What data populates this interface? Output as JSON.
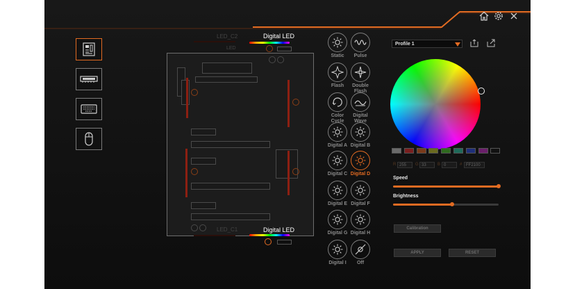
{
  "window": {
    "home_icon": "home-icon",
    "settings_icon": "gear-icon",
    "close_icon": "close-icon"
  },
  "sidebar": {
    "items": [
      {
        "name": "motherboard",
        "icon": "motherboard-icon",
        "active": true
      },
      {
        "name": "memory",
        "icon": "memory-icon",
        "active": false
      },
      {
        "name": "keyboard",
        "icon": "keyboard-icon",
        "active": false
      },
      {
        "name": "mouse",
        "icon": "mouse-icon",
        "active": false
      }
    ]
  },
  "board": {
    "led_c2": "LED_C2",
    "led_c1": "LED_C1",
    "digital_led_top": "Digital LED",
    "digital_led_bottom": "Digital LED",
    "led_small": "LED"
  },
  "effects": [
    {
      "label": "Static",
      "icon": "sun-icon"
    },
    {
      "label": "Pulse",
      "icon": "wave-icon"
    },
    {
      "label": "Flash",
      "icon": "flash-icon"
    },
    {
      "label": "Double\nFlash",
      "icon": "double-flash-icon"
    },
    {
      "label": "Color\nCycle",
      "icon": "color-cycle-icon"
    },
    {
      "label": "Digital\nWave",
      "icon": "digital-wave-icon"
    },
    {
      "label": "Digital A",
      "icon": "sun-icon"
    },
    {
      "label": "Digital B",
      "icon": "sun-icon"
    },
    {
      "label": "Digital C",
      "icon": "sun-icon"
    },
    {
      "label": "Digital D",
      "icon": "sun-icon",
      "active": true
    },
    {
      "label": "Digital E",
      "icon": "sun-icon"
    },
    {
      "label": "Digital F",
      "icon": "sun-icon"
    },
    {
      "label": "Digital G",
      "icon": "sun-icon"
    },
    {
      "label": "Digital H",
      "icon": "sun-icon"
    },
    {
      "label": "Digital I",
      "icon": "sun-icon"
    },
    {
      "label": "Off",
      "icon": "off-icon"
    }
  ],
  "profile": {
    "selected": "Profile 1",
    "import_icon": "import-icon",
    "export_icon": "export-icon"
  },
  "swatches": [
    "#6b6b6b",
    "#7a1f1f",
    "#7a3a1a",
    "#6b6b1f",
    "#2f6b1f",
    "#1f6b5a",
    "#1f2f7a",
    "#6b1f6b",
    "#111111"
  ],
  "rgb": {
    "r_label": "R",
    "r": "255",
    "g_label": "G",
    "g": "33",
    "b_label": "B",
    "b": "0",
    "hex_label": "#",
    "hex": "FF2100"
  },
  "speed": {
    "label": "Speed",
    "value": 1.0
  },
  "brightness": {
    "label": "Brightness",
    "value": 0.56
  },
  "buttons": {
    "calibration": "Calibration",
    "apply": "APPLY",
    "reset": "RESET"
  },
  "colors": {
    "accent": "#e26b22",
    "background": "#141414"
  }
}
